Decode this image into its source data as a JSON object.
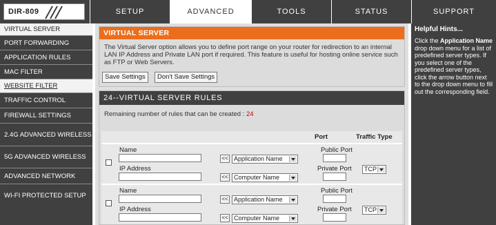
{
  "header": {
    "model": "DIR-809",
    "tabs": [
      {
        "label": "SETUP",
        "active": false
      },
      {
        "label": "ADVANCED",
        "active": true
      },
      {
        "label": "TOOLS",
        "active": false
      },
      {
        "label": "STATUS",
        "active": false
      },
      {
        "label": "SUPPORT",
        "active": false
      }
    ]
  },
  "sidebar": {
    "items": [
      {
        "label": "VIRTUAL SERVER"
      },
      {
        "label": "PORT FORWARDING"
      },
      {
        "label": "APPLICATION RULES"
      },
      {
        "label": "MAC FILTER"
      },
      {
        "label": "WEBSITE FILTER"
      },
      {
        "label": "TRAFFIC CONTROL"
      },
      {
        "label": "FIREWALL SETTINGS"
      },
      {
        "label": "2.4G ADVANCED WIRELESS"
      },
      {
        "label": "5G ADVANCED WIRELESS"
      },
      {
        "label": "ADVANCED NETWORK"
      },
      {
        "label": "WI-FI PROTECTED SETUP"
      }
    ]
  },
  "virtual_server": {
    "title": "VIRTUAL SERVER",
    "description": "The Virtual Server option allows you to define port range on your router for redirection to an internal LAN IP Address and Private LAN port if required. This feature is useful for hosting online service such as FTP or Web Servers.",
    "save_label": "Save Settings",
    "dont_save_label": "Don't Save Settings"
  },
  "rules": {
    "title": "24--VIRTUAL SERVER RULES",
    "remaining_label": "Remaining number of rules that can be created : ",
    "remaining_count": "24",
    "col_port": "Port",
    "col_traffic": "Traffic Type",
    "name_label": "Name",
    "ip_label": "IP Address",
    "public_port_label": "Public Port",
    "private_port_label": "Private Port",
    "app_select": "Application Name",
    "computer_select": "Computer Name",
    "traffic_value": "TCP",
    "arrow_label": "<<"
  },
  "hints": {
    "title": "Helpful Hints...",
    "text_pre": "Click the ",
    "text_bold": "Application Name",
    "text_post": " drop down menu for a list of predefined server types. If you select one of the predefined server types, click the arrow button next to the drop down menu to fill out the corresponding field."
  }
}
